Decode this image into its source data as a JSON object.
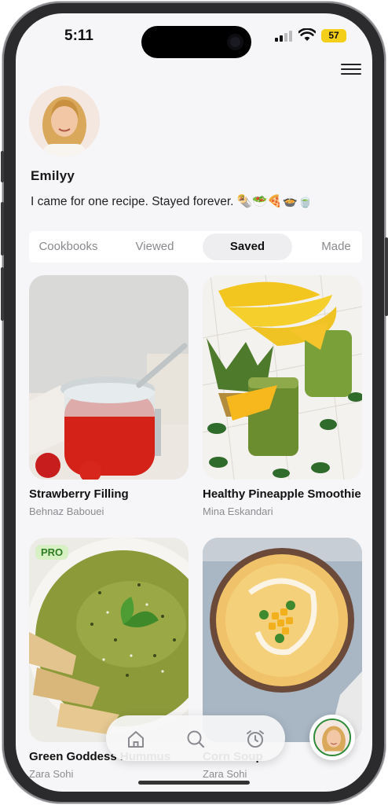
{
  "status_bar": {
    "time": "5:11",
    "battery": "57"
  },
  "profile": {
    "name": "Emilyy",
    "bio": "I came for one recipe. Stayed forever. 🌯🥗🍕🍲🍵"
  },
  "tabs": [
    {
      "label": "Cookbooks",
      "active": false
    },
    {
      "label": "Viewed",
      "active": false
    },
    {
      "label": "Saved",
      "active": true
    },
    {
      "label": "Made",
      "active": false
    }
  ],
  "recipes": [
    {
      "title": "Strawberry Filling",
      "author": "Behnaz Babouei",
      "badge": ""
    },
    {
      "title": "Healthy Pineapple Smoothie",
      "author": "Mina Eskandari",
      "badge": ""
    },
    {
      "title": "Green Goddess Hummus",
      "author": "Zara Sohi",
      "badge": "PRO"
    },
    {
      "title": "Corn Soup",
      "author": "Zara Sohi",
      "badge": ""
    }
  ],
  "nav": {
    "icons": [
      "home-icon",
      "search-icon",
      "alarm-clock-icon"
    ]
  },
  "colors": {
    "accent_green": "#2e8b3a",
    "battery": "#f4cf1a",
    "pro_badge_bg": "#d7f0c4"
  }
}
